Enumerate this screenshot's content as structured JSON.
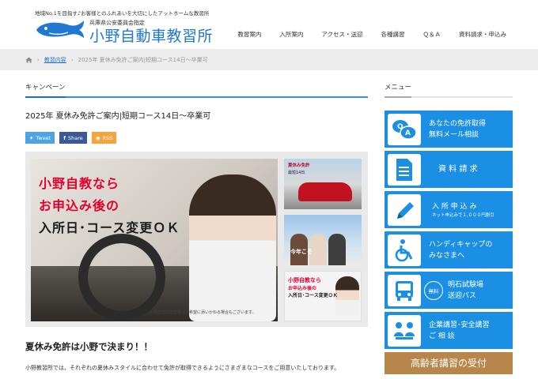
{
  "header": {
    "tagline": "地域No.1を目指す♪お客様とのふれあいを大切にしたアットホームな教習所",
    "logo_sub": "兵庫県公安委員会指定",
    "logo_main": "小野自動車教習所",
    "nav": [
      "教習案内",
      "入所案内",
      "アクセス・送迎",
      "各種講習",
      "Ｑ＆Ａ",
      "資料請求・申込み"
    ]
  },
  "breadcrumb": {
    "home_icon": "home-icon",
    "items": [
      "教習内容",
      "2025年 夏休み免許ご案内|短期コース14日〜卒業可"
    ]
  },
  "main": {
    "section_title": "キャンペーン",
    "post_title": "2025年 夏休み免許ご案内|短期コース14日〜卒業可",
    "share": {
      "tweet": "Tweet",
      "share": "Share",
      "rss": "RSS"
    },
    "hero": {
      "line1": "小野自教なら",
      "line2": "お申込み後の",
      "line3": "入所日･コース変更ＯＫ",
      "note": "入所前日での変更はご希望に添いかねる場合もございます。",
      "thumb1_caption1": "夏休み免許",
      "thumb1_caption2": "最短14日",
      "thumb2_caption": "今年こそ",
      "thumb3_caption1": "小野自教なら",
      "thumb3_caption2": "お申込み後の",
      "thumb3_caption3": "入所日･コース変更ＯＫ"
    },
    "sub_heading": "夏休み免許は小野で決まり！！",
    "body_text": "小野教習所では、それぞれの夏休みスタイルに合わせて免許が取得できるようにさまざまなコースをご用意いたしております。"
  },
  "sidebar": {
    "title": "メニュー",
    "items": [
      {
        "line1": "あなたの免許取得",
        "line2": "無料メール相談",
        "icon": "qa-icon"
      },
      {
        "line1": "資 料 請 求",
        "line2": "",
        "icon": "document-icon"
      },
      {
        "line1": "入 所 申 込 み",
        "small": "ネット申込みで１,０００円割引",
        "icon": "pencil-icon"
      },
      {
        "line1": "ハンディキャップの",
        "line2": "みなさまへ",
        "icon": "wheelchair-icon"
      },
      {
        "line1": "明石試験場",
        "line2": "送迎バス",
        "icon": "bus-icon",
        "badge": "無料"
      },
      {
        "line1": "企業講習･安全講習",
        "line2": "ご 相 談",
        "icon": "meeting-icon"
      },
      {
        "line1": "高齢者講習の受付",
        "line2": "",
        "icon": ""
      }
    ]
  },
  "colors": {
    "accent": "#1a8fe3",
    "logo": "#1f78d1",
    "red": "#e4002b",
    "orange": "#b8864a"
  }
}
